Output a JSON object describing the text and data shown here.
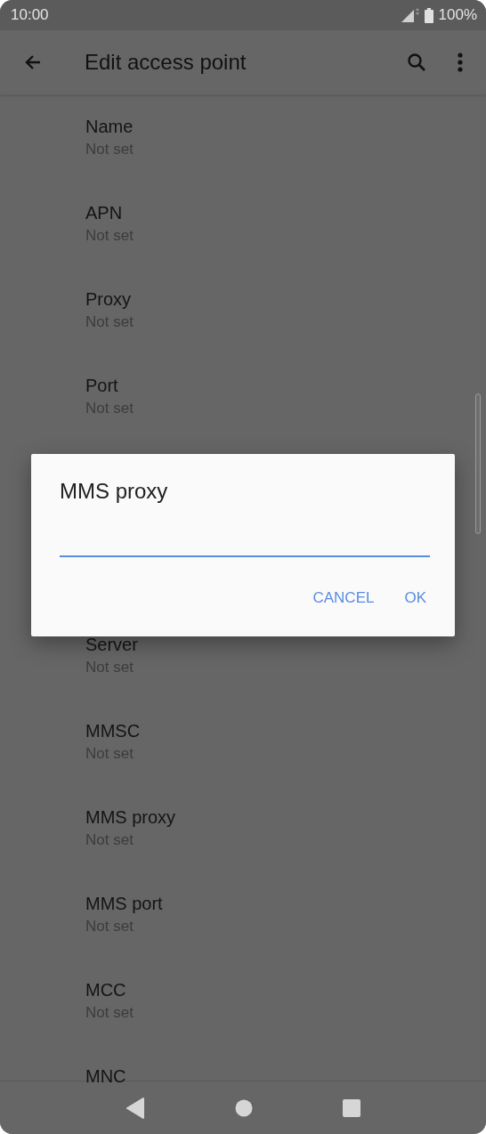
{
  "status_bar": {
    "time": "10:00",
    "battery": "100%"
  },
  "app_bar": {
    "title": "Edit access point"
  },
  "settings": [
    {
      "title": "Name",
      "summary": "Not set"
    },
    {
      "title": "APN",
      "summary": "Not set"
    },
    {
      "title": "Proxy",
      "summary": "Not set"
    },
    {
      "title": "Port",
      "summary": "Not set"
    },
    {
      "kind": "gap"
    },
    {
      "title": "Server",
      "summary": "Not set"
    },
    {
      "title": "MMSC",
      "summary": "Not set"
    },
    {
      "title": "MMS proxy",
      "summary": "Not set"
    },
    {
      "title": "MMS port",
      "summary": "Not set"
    },
    {
      "title": "MCC",
      "summary": "Not set"
    },
    {
      "title": "MNC"
    }
  ],
  "dialog": {
    "title": "MMS proxy",
    "buttons": [
      "CANCEL",
      "OK"
    ]
  }
}
